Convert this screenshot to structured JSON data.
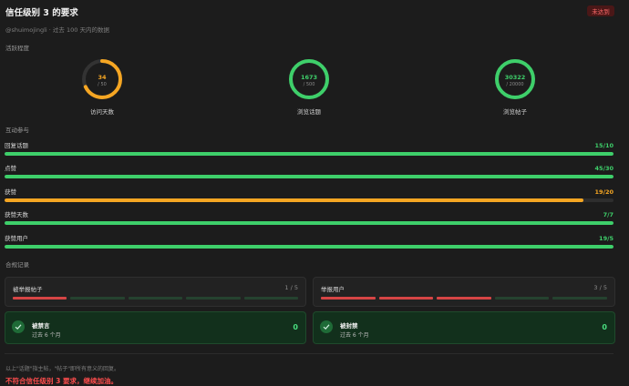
{
  "header": {
    "title": "信任级别 3 的要求",
    "badge": "未达到",
    "subtitle": "@shuimojingli · 过去 100 天内的数据"
  },
  "activity": {
    "section_title": "活跃程度",
    "rings": [
      {
        "value": "34",
        "target": "/ 50",
        "label": "访问天数",
        "ratio": 0.68,
        "color": "#f5a623"
      },
      {
        "value": "1673",
        "target": "/ 500",
        "label": "浏览话题",
        "ratio": 1.0,
        "color": "#3ecf6a"
      },
      {
        "value": "30322",
        "target": "/ 20000",
        "label": "浏览帖子",
        "ratio": 1.0,
        "color": "#3ecf6a"
      }
    ]
  },
  "interaction": {
    "section_title": "互动参与",
    "bars": [
      {
        "name": "回复话题",
        "value": "15/10",
        "fraction": 1.0,
        "color": "#3ecf6a"
      },
      {
        "name": "点赞",
        "value": "45/30",
        "fraction": 1.0,
        "color": "#3ecf6a"
      },
      {
        "name": "获赞",
        "value": "19/20",
        "fraction": 0.95,
        "color": "#f5a623"
      },
      {
        "name": "获赞天数",
        "value": "7/7",
        "fraction": 1.0,
        "color": "#3ecf6a"
      },
      {
        "name": "获赞用户",
        "value": "19/5",
        "fraction": 1.0,
        "color": "#3ecf6a"
      }
    ]
  },
  "compliance": {
    "section_title": "合规记录",
    "reported_posts": {
      "title": "被举报帖子",
      "count": "1 / 5",
      "filled": 1,
      "total": 5
    },
    "reporting_users": {
      "title": "举报用户",
      "count": "3 / 5",
      "filled": 3,
      "total": 5
    },
    "silenced": {
      "title": "被禁言",
      "sub": "过去 6 个月",
      "value": "0"
    },
    "suspended": {
      "title": "被封禁",
      "sub": "过去 6 个月",
      "value": "0"
    }
  },
  "footer": {
    "note": "以上\"话题\"指主帖，\"帖子\"即所有意义的回复。",
    "result": "不符合信任级别 3 要求，继续加油。"
  },
  "colors": {
    "green": "#3ecf6a",
    "orange": "#f5a623",
    "red": "#d64545",
    "track": "#2e2e2e"
  }
}
